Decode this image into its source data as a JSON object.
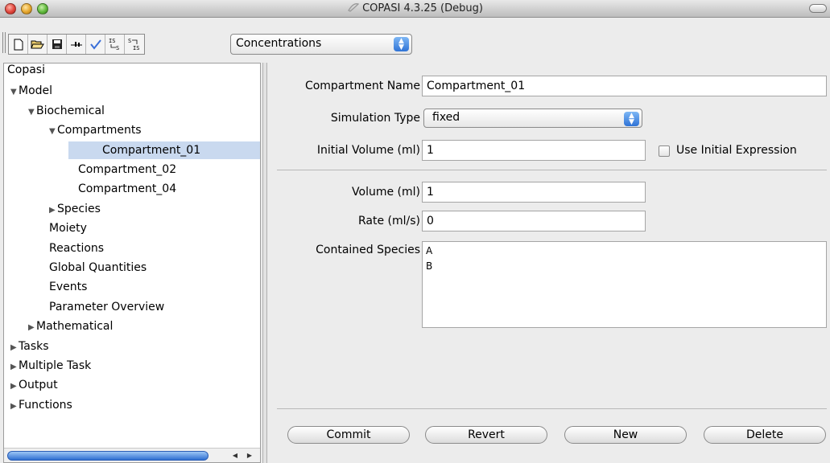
{
  "window": {
    "title": "COPASI 4.3.25 (Debug)"
  },
  "toolbar": {
    "buttons": [
      {
        "name": "new-file-icon",
        "glyph": "▯"
      },
      {
        "name": "open-folder-icon",
        "glyph": "📂"
      },
      {
        "name": "save-icon",
        "glyph": "■"
      },
      {
        "name": "slider-icon",
        "glyph": "⫞"
      },
      {
        "name": "checkmark-icon",
        "glyph": "✓"
      },
      {
        "name": "is-to-s-icon",
        "glyph": "IS→S"
      },
      {
        "name": "s-to-is-icon",
        "glyph": "S→IS"
      }
    ],
    "units_select": "Concentrations"
  },
  "tree": {
    "items": [
      {
        "label": "Copasi",
        "level": 0,
        "arrow": ""
      },
      {
        "label": "Model",
        "level": 1,
        "arrow": "▼"
      },
      {
        "label": "Biochemical",
        "level": 2,
        "arrow": "▼"
      },
      {
        "label": "Compartments",
        "level": 3,
        "arrow": "▼"
      },
      {
        "label": "Compartment_01",
        "level": 4,
        "arrow": "",
        "selected": true
      },
      {
        "label": "Compartment_02",
        "level": 4,
        "arrow": ""
      },
      {
        "label": "Compartment_04",
        "level": 4,
        "arrow": ""
      },
      {
        "label": "Species",
        "level": 3,
        "arrow": "▶"
      },
      {
        "label": "Moiety",
        "level": 3,
        "arrow": ""
      },
      {
        "label": "Reactions",
        "level": 3,
        "arrow": ""
      },
      {
        "label": "Global Quantities",
        "level": 3,
        "arrow": ""
      },
      {
        "label": "Events",
        "level": 3,
        "arrow": ""
      },
      {
        "label": "Parameter Overview",
        "level": 3,
        "arrow": ""
      },
      {
        "label": "Mathematical",
        "level": 2,
        "arrow": "▶"
      },
      {
        "label": "Tasks",
        "level": 1,
        "arrow": "▶"
      },
      {
        "label": "Multiple Task",
        "level": 1,
        "arrow": "▶"
      },
      {
        "label": "Output",
        "level": 1,
        "arrow": "▶"
      },
      {
        "label": "Functions",
        "level": 1,
        "arrow": "▶"
      }
    ]
  },
  "form": {
    "compartment_name_label": "Compartment Name",
    "compartment_name_value": "Compartment_01",
    "simulation_type_label": "Simulation Type",
    "simulation_type_value": "fixed",
    "initial_volume_label": "Initial Volume (ml)",
    "initial_volume_value": "1",
    "use_initial_expression_label": "Use Initial Expression",
    "volume_label": "Volume (ml)",
    "volume_value": "1",
    "rate_label": "Rate (ml/s)",
    "rate_value": "0",
    "contained_species_label": "Contained Species",
    "contained_species": [
      "A",
      "B"
    ]
  },
  "buttons": {
    "commit": "Commit",
    "revert": "Revert",
    "new": "New",
    "delete": "Delete"
  }
}
